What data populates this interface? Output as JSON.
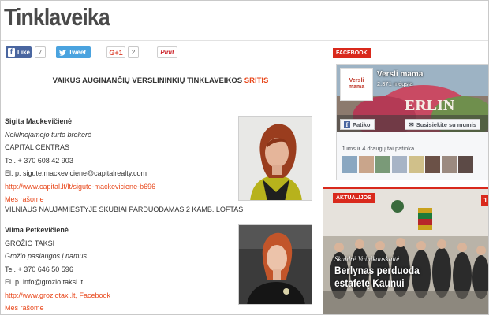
{
  "page": {
    "title": "Tinklaveika"
  },
  "share": {
    "like_label": "Like",
    "like_count": "7",
    "tweet_label": "Tweet",
    "gplus_label": "G+1",
    "gplus_count": "2",
    "pinit_label": "Pinit"
  },
  "main": {
    "heading_prefix": "VAIKUS AUGINANČIŲ VERSLININKIŲ TINKLAVEIKOS",
    "heading_highlight": "SRITIS",
    "entries": [
      {
        "name": "Sigita Mackevičienė",
        "role": "Nekilnojamojo turto brokerė",
        "company": "CAPITAL CENTRAS",
        "phone": "Tel. + 370 608 42 903",
        "email": "El. p. sigute.mackeviciene@capitalrealty.com",
        "link": "http://www.capital.lt/lt/sigute-mackeviciene-b696",
        "contact": "Mes rašome",
        "listing": "VILNIAUS NAUJAMIESTYJE SKUBIAI PARDUODAMAS 2 KAMB. LOFTAS"
      },
      {
        "name": "Vilma Petkevičienė",
        "company": "GROŽIO TAKSI",
        "role": "Grožio paslaugos į namus",
        "phone": "Tel. + 370 646 50 596",
        "email": "El. p. info@grozio taksi.lt",
        "link": "http://www.groziotaxi.lt, Facebook",
        "contact": "Mes rašome"
      }
    ]
  },
  "sidebar": {
    "facebook_label": "FACEBOOK",
    "fb_logo_text": "Versli mama",
    "fb_page_name": "Versli mama",
    "fb_page_likes": "2.371 mėgsta",
    "fb_like_button": "Patiko",
    "fb_message_button": "Susisiekite su mumis",
    "fb_friends_text": "Jums ir 4 draugų tai patinka",
    "news_label": "AKTUALIJOS",
    "news_number": "1",
    "news_author": "Skaidrė Vainikauskaitė",
    "news_headline": "Berlynas perduoda estafetę Kaunui"
  },
  "colors": {
    "accent": "#e8481c",
    "label_red": "#d9291c",
    "facebook_blue": "#4a66a0",
    "twitter_blue": "#4aa3df"
  }
}
